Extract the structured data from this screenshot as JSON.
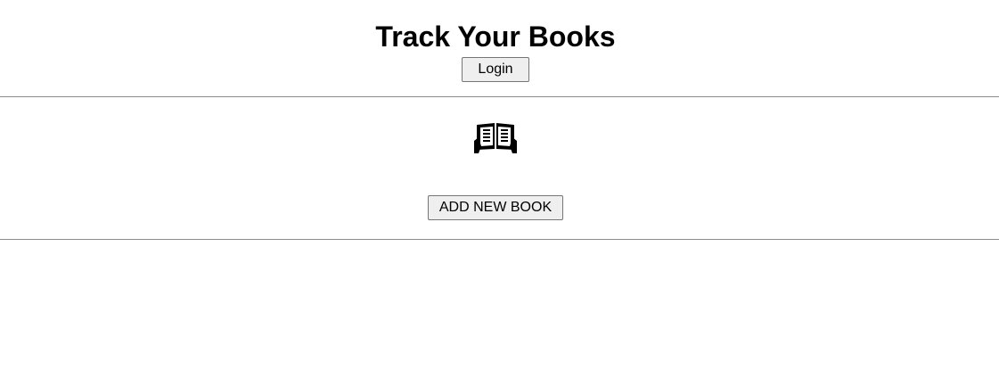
{
  "header": {
    "title": "Track Your Books",
    "login_label": "Login"
  },
  "main": {
    "icon": "book-reading-icon",
    "add_book_label": "ADD NEW BOOK"
  },
  "colors": {
    "background": "#ffffff",
    "text": "#000000",
    "button_bg": "#efefef",
    "button_border": "#767676",
    "divider": "#8a8a8a"
  }
}
